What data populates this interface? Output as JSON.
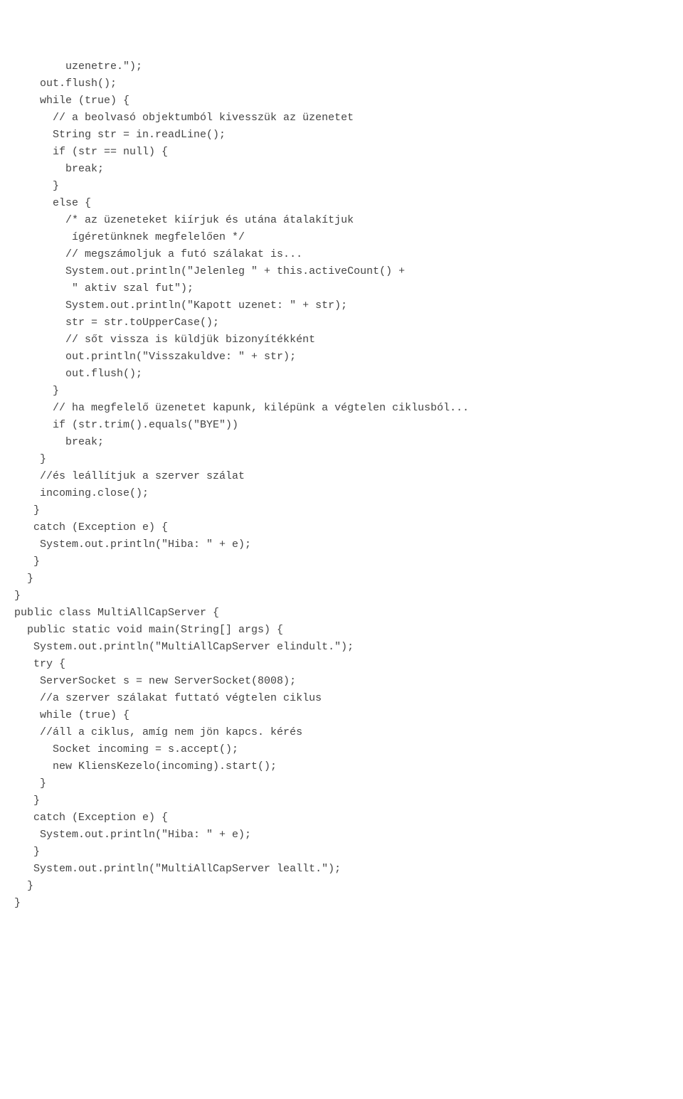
{
  "lines": [
    "        uzenetre.\");",
    "    out.flush();",
    "    while (true) {",
    "      // a beolvasó objektumból kivesszük az üzenetet",
    "      String str = in.readLine();",
    "      if (str == null) {",
    "        break;",
    "      }",
    "      else {",
    "        /* az üzeneteket kiírjuk és utána átalakítjuk",
    "         ígéretünknek megfelelően */",
    "        // megszámoljuk a futó szálakat is...",
    "        System.out.println(\"Jelenleg \" + this.activeCount() +",
    "         \" aktiv szal fut\");",
    "        System.out.println(\"Kapott uzenet: \" + str);",
    "        str = str.toUpperCase();",
    "        // sőt vissza is küldjük bizonyítékként",
    "        out.println(\"Visszakuldve: \" + str);",
    "        out.flush();",
    "      }",
    "      // ha megfelelő üzenetet kapunk, kilépünk a végtelen ciklusból...",
    "      if (str.trim().equals(\"BYE\"))",
    "        break;",
    "    }",
    "    //és leállítjuk a szerver szálat",
    "    incoming.close();",
    "   }",
    "   catch (Exception e) {",
    "    System.out.println(\"Hiba: \" + e);",
    "   }",
    "  }",
    "}",
    "",
    "public class MultiAllCapServer {",
    "",
    "  public static void main(String[] args) {",
    "   System.out.println(\"MultiAllCapServer elindult.\");",
    "   try {",
    "    ServerSocket s = new ServerSocket(8008);",
    "    //a szerver szálakat futtató végtelen ciklus",
    "    while (true) {",
    "    //áll a ciklus, amíg nem jön kapcs. kérés",
    "      Socket incoming = s.accept();",
    "      new KliensKezelo(incoming).start();",
    "    }",
    "   }",
    "   catch (Exception e) {",
    "    System.out.println(\"Hiba: \" + e);",
    "   }",
    "   System.out.println(\"MultiAllCapServer leallt.\");",
    "  }",
    "}"
  ]
}
